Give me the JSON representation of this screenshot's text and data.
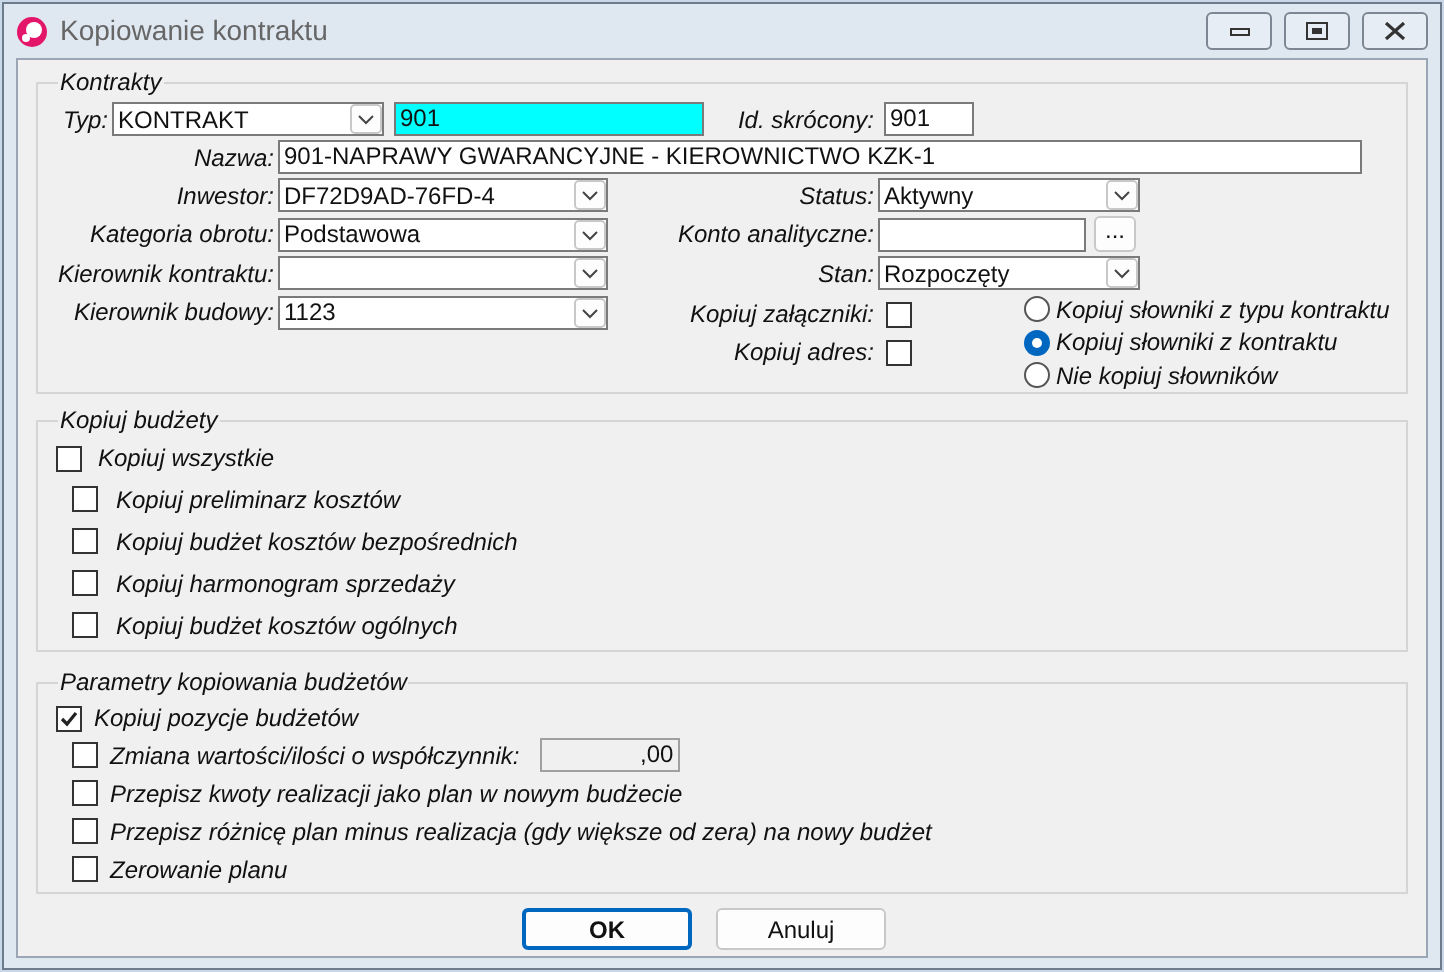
{
  "window": {
    "title": "Kopiowanie kontraktu"
  },
  "contracts": {
    "legend": "Kontrakty",
    "type": {
      "label": "Typ:",
      "value": "KONTRAKT"
    },
    "code": {
      "value": "901"
    },
    "short_id": {
      "label": "Id. skrócony:",
      "value": "901"
    },
    "name": {
      "label": "Nazwa:",
      "value": "901-NAPRAWY GWARANCYJNE - KIEROWNICTWO KZK-1"
    },
    "left_fields": [
      {
        "label": "Inwestor:",
        "value": "DF72D9AD-76FD-4"
      },
      {
        "label": "Kategoria obrotu:",
        "value": "Podstawowa"
      },
      {
        "label": "Kierownik kontraktu:"
      },
      {
        "label": "Kierownik budowy:",
        "value": "1123"
      }
    ],
    "right_fields": [
      {
        "kind": "combo",
        "label": "Status:",
        "value": "Aktywny"
      },
      {
        "kind": "lookup",
        "label": "Konto analityczne:",
        "button": "..."
      },
      {
        "kind": "combo",
        "label": "Stan:",
        "value": "Rozpoczęty"
      }
    ],
    "options": [
      {
        "label": "Kopiuj załączniki:",
        "checked": false
      },
      {
        "label": "Kopiuj adres:",
        "checked": false
      }
    ],
    "dictionary_options": [
      {
        "label": "Kopiuj słowniki z typu kontraktu",
        "selected": false
      },
      {
        "label": "Kopiuj słowniki z kontraktu",
        "selected": true
      },
      {
        "label": "Nie kopiuj słowników",
        "selected": false
      }
    ]
  },
  "budgets": {
    "legend": "Kopiuj budżety",
    "all": {
      "label": "Kopiuj wszystkie",
      "checked": false
    },
    "items": [
      {
        "label": "Kopiuj preliminarz kosztów",
        "checked": false
      },
      {
        "label": "Kopiuj budżet kosztów bezpośrednich",
        "checked": false
      },
      {
        "label": "Kopiuj harmonogram sprzedaży",
        "checked": false
      },
      {
        "label": "Kopiuj budżet kosztów ogólnych",
        "checked": false
      }
    ]
  },
  "params": {
    "legend": "Parametry kopiowania budżetów",
    "main": {
      "label": "Kopiuj pozycje budżetów",
      "checked": true
    },
    "items": [
      {
        "kind": "factor",
        "label": "Zmiana wartości/ilości o współczynnik:",
        "checked": false,
        "value": ",00"
      },
      {
        "kind": "plain",
        "label": "Przepisz kwoty realizacji jako plan w nowym budżecie",
        "checked": false
      },
      {
        "kind": "plain",
        "label": "Przepisz różnicę plan minus realizacja (gdy większe od zera) na nowy budżet",
        "checked": false
      },
      {
        "kind": "plain",
        "label": "Zerowanie planu",
        "checked": false
      }
    ]
  },
  "buttons": [
    {
      "label": "OK",
      "default": true
    },
    {
      "label": "Anuluj",
      "default": false
    }
  ]
}
